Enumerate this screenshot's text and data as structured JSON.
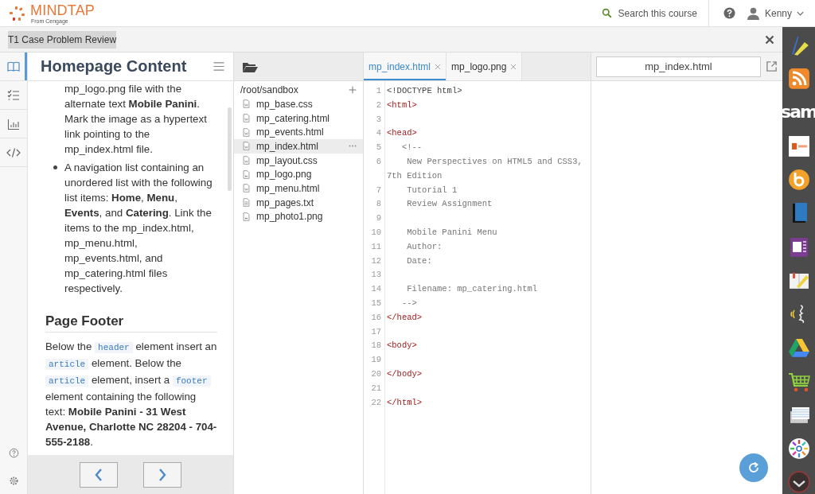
{
  "header": {
    "brand": "MINDTAP",
    "brand_sub": "From Cengage",
    "search": "Search this course",
    "user": "Kenny"
  },
  "title_bar": {
    "title": "T1 Case Problem Review"
  },
  "rail": [
    {
      "kind": "book",
      "selected": true
    },
    {
      "kind": "checklist",
      "selected": false
    },
    {
      "kind": "chart",
      "selected": false
    },
    {
      "kind": "code",
      "selected": false
    }
  ],
  "rail_bottom": [
    {
      "kind": "help"
    },
    {
      "kind": "settings"
    }
  ],
  "reading": {
    "title": "Homepage Content",
    "content": [
      {
        "kind": "continued",
        "text": "mp_logo.png file with the alternate text **Mobile Panini**. Mark the image as a hypertext link pointing to the mp_index.html file."
      },
      {
        "kind": "bullet",
        "text": "A navigation list containing an unordered list with the following list items: **Home**, **Menu**, **Events**, and **Catering**. Link the items to the mp_index.html, mp_menu.html, mp_events.html, and mp_catering.html files respectively."
      },
      {
        "kind": "heading",
        "text": "Page Footer"
      },
      {
        "kind": "paragraph",
        "segments": [
          {
            "kind": "text",
            "text": "Below the "
          },
          {
            "kind": "code",
            "text": "header"
          },
          {
            "kind": "text",
            "text": " element insert an "
          },
          {
            "kind": "code",
            "text": "article"
          },
          {
            "kind": "text",
            "text": " element. Below the "
          },
          {
            "kind": "code",
            "text": "article"
          },
          {
            "kind": "text",
            "text": " element, insert a "
          },
          {
            "kind": "code",
            "text": "footer"
          },
          {
            "kind": "text",
            "text": " element containing the following text: **Mobile Panini - 31 West Avenue, Charlotte NC 28204 - 704-555-2188**."
          }
        ]
      }
    ]
  },
  "files": {
    "path": "/root/sandbox",
    "items": [
      {
        "name": "mp_base.css",
        "kind": "code",
        "selected": false
      },
      {
        "name": "mp_catering.html",
        "kind": "code",
        "selected": false
      },
      {
        "name": "mp_events.html",
        "kind": "code",
        "selected": false
      },
      {
        "name": "mp_index.html",
        "kind": "code",
        "selected": true
      },
      {
        "name": "mp_layout.css",
        "kind": "code",
        "selected": false
      },
      {
        "name": "mp_logo.png",
        "kind": "image",
        "selected": false
      },
      {
        "name": "mp_menu.html",
        "kind": "code",
        "selected": false
      },
      {
        "name": "mp_pages.txt",
        "kind": "text",
        "selected": false
      },
      {
        "name": "mp_photo1.png",
        "kind": "image",
        "selected": false
      }
    ]
  },
  "editor": {
    "tabs": [
      {
        "label": "mp_index.html",
        "selected": true
      },
      {
        "label": "mp_logo.png",
        "selected": false
      }
    ],
    "lines": [
      {
        "num": "1",
        "kind": "plain",
        "text": "<!DOCTYPE html>"
      },
      {
        "num": "2",
        "kind": "tag",
        "text": "<html>"
      },
      {
        "num": "3"
      },
      {
        "num": "4",
        "kind": "tag",
        "text": "<head>"
      },
      {
        "num": "5",
        "kind": "comment",
        "text": "   <!--"
      },
      {
        "num": "6",
        "kind": "comment",
        "text": "    New Perspectives on HTML5 and CSS3, 7th Edition"
      },
      {
        "num": "7",
        "kind": "comment",
        "text": "    Tutorial 1"
      },
      {
        "num": "8",
        "kind": "comment",
        "text": "    Review Assignment"
      },
      {
        "num": "9"
      },
      {
        "num": "10",
        "kind": "comment",
        "text": "    Mobile Panini Menu"
      },
      {
        "num": "11",
        "kind": "comment",
        "text": "    Author:"
      },
      {
        "num": "12",
        "kind": "comment",
        "text": "    Date:"
      },
      {
        "num": "13"
      },
      {
        "num": "14",
        "kind": "comment",
        "text": "    Filename: mp_catering.html"
      },
      {
        "num": "15",
        "kind": "comment",
        "text": "   -->"
      },
      {
        "num": "16",
        "kind": "tag",
        "text": "</head>"
      },
      {
        "num": "17"
      },
      {
        "num": "18",
        "kind": "tag",
        "text": "<body>"
      },
      {
        "num": "19"
      },
      {
        "num": "20",
        "kind": "tag",
        "text": "</body>"
      },
      {
        "num": "21"
      },
      {
        "num": "22",
        "kind": "tag",
        "text": "</html>"
      }
    ]
  },
  "preview": {
    "address": "mp_index.html"
  },
  "dock": [
    {
      "kind": "pens"
    },
    {
      "kind": "rss"
    },
    {
      "kind": "sam",
      "label": "sam"
    },
    {
      "kind": "office"
    },
    {
      "kind": "ring"
    },
    {
      "kind": "book"
    },
    {
      "kind": "notebook"
    },
    {
      "kind": "notepad"
    },
    {
      "kind": "voice"
    },
    {
      "kind": "drive"
    },
    {
      "kind": "cart"
    },
    {
      "kind": "cards"
    },
    {
      "kind": "wheel"
    },
    {
      "kind": "badge"
    }
  ]
}
